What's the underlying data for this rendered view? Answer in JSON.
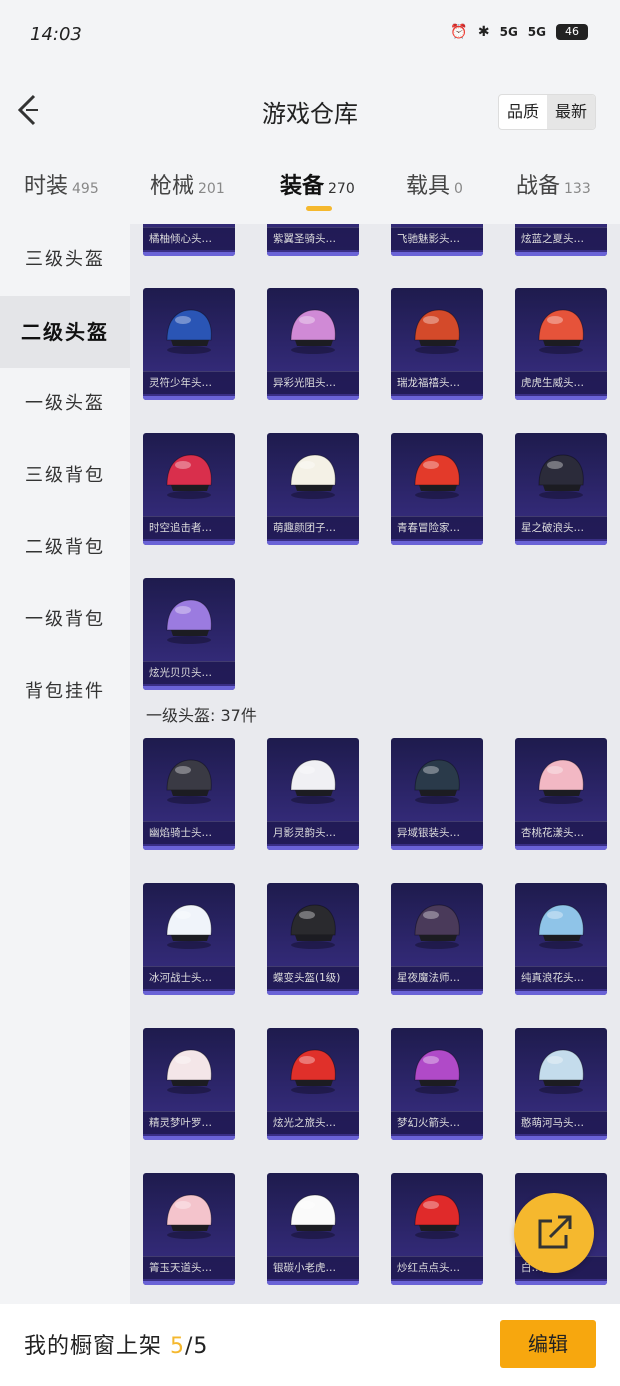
{
  "status": {
    "time": "14:03",
    "battery": "46",
    "sig1": "5G",
    "sig2": "5G"
  },
  "header": {
    "title": "游戏仓库",
    "sort_quality": "品质",
    "sort_newest": "最新"
  },
  "tabs": [
    {
      "label": "时装",
      "count": "495"
    },
    {
      "label": "枪械",
      "count": "201"
    },
    {
      "label": "装备",
      "count": "270"
    },
    {
      "label": "载具",
      "count": "0"
    },
    {
      "label": "战备",
      "count": "133"
    }
  ],
  "sidebar": [
    "三级头盔",
    "二级头盔",
    "一级头盔",
    "三级背包",
    "二级背包",
    "一级背包",
    "背包挂件"
  ],
  "partial_row": [
    "橘柚倾心头…",
    "紫翼圣骑头…",
    "飞驰魅影头…",
    "炫蓝之夏头…"
  ],
  "level2_items": [
    {
      "name": "灵符少年头…",
      "color": "#2a55b5"
    },
    {
      "name": "异彩光阻头…",
      "color": "#d08ad6"
    },
    {
      "name": "瑞龙福禧头…",
      "color": "#d44a2a"
    },
    {
      "name": "虎虎生威头…",
      "color": "#e6533a"
    },
    {
      "name": "时空追击者…",
      "color": "#d92f4c"
    },
    {
      "name": "萌趣颜团子…",
      "color": "#f4f1e6"
    },
    {
      "name": "青春冒险家…",
      "color": "#e33a2a"
    },
    {
      "name": "星之破浪头…",
      "color": "#2b2b3a"
    },
    {
      "name": "炫光贝贝头…",
      "color": "#9b7be0"
    }
  ],
  "level1_label": "一级头盔: 37件",
  "level1_items": [
    {
      "name": "幽焰骑士头…",
      "color": "#3a3a44"
    },
    {
      "name": "月影灵韵头…",
      "color": "#f0f0f4"
    },
    {
      "name": "异域银装头…",
      "color": "#2a3a4a"
    },
    {
      "name": "杏桃花漾头…",
      "color": "#f2b8c4"
    },
    {
      "name": "冰河战士头…",
      "color": "#f0f4fa"
    },
    {
      "name": "蝶变头盔(1级)",
      "color": "#2a2a2e"
    },
    {
      "name": "星夜魔法师…",
      "color": "#4a3a5a"
    },
    {
      "name": "纯真浪花头…",
      "color": "#8fc4e8"
    },
    {
      "name": "精灵梦叶罗…",
      "color": "#f4e6e8"
    },
    {
      "name": "炫光之旅头…",
      "color": "#e0302a"
    },
    {
      "name": "梦幻火箭头…",
      "color": "#b04ac8"
    },
    {
      "name": "憨萌河马头…",
      "color": "#c4dcec"
    },
    {
      "name": "箐玉天道头…",
      "color": "#f4c4cc"
    },
    {
      "name": "银碳小老虎…",
      "color": "#fafafa"
    },
    {
      "name": "炒红点点头…",
      "color": "#e02a2a"
    },
    {
      "name": "白…头…",
      "color": "#f2f2f2"
    }
  ],
  "bottom": {
    "text": "我的橱窗上架 ",
    "used": "5",
    "total": "/5",
    "edit": "编辑"
  }
}
